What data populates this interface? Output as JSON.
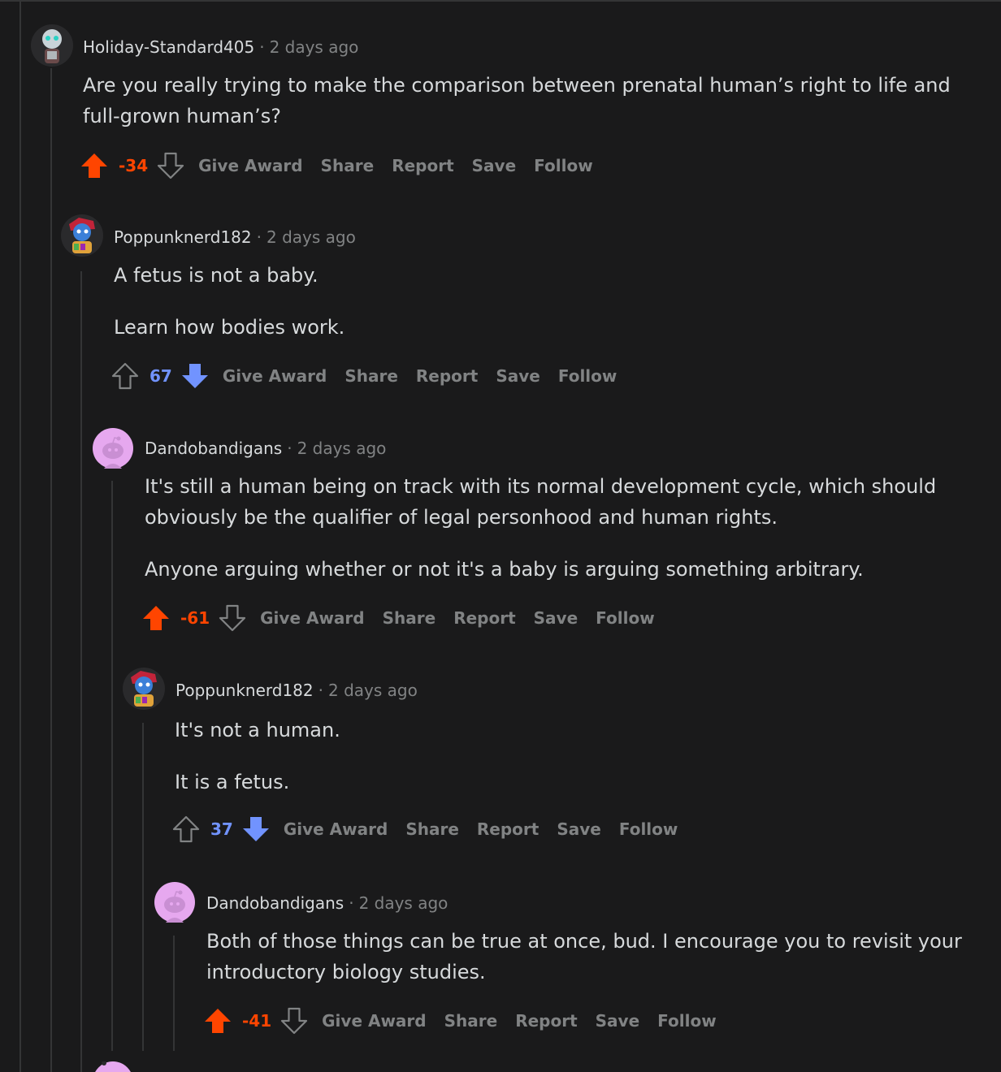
{
  "comments": [
    {
      "username": "Holiday-Standard405",
      "time": "2 days ago",
      "avatar": "snoo-avatar-grey",
      "paragraphs": [
        "Are you really trying to make the comparison between prenatal human’s right to life and full-grown human’s?"
      ],
      "score": "-34",
      "vote": "up",
      "actions": [
        "Give Award",
        "Share",
        "Report",
        "Save",
        "Follow"
      ]
    },
    {
      "username": "Poppunknerd182",
      "time": "2 days ago",
      "avatar": "snoo-avatar-rainbow",
      "paragraphs": [
        "A fetus is not a baby.",
        "Learn how bodies work."
      ],
      "score": "67",
      "vote": "down",
      "actions": [
        "Give Award",
        "Share",
        "Report",
        "Save",
        "Follow"
      ]
    },
    {
      "username": "Dandobandigans",
      "time": "2 days ago",
      "avatar": "default-snoo-pink",
      "paragraphs": [
        "It's still a human being on track with its normal development cycle, which should obviously be the qualifier of legal personhood and human rights.",
        "Anyone arguing whether or not it's a baby is arguing something arbitrary."
      ],
      "score": "-61",
      "vote": "up",
      "actions": [
        "Give Award",
        "Share",
        "Report",
        "Save",
        "Follow"
      ]
    },
    {
      "username": "Poppunknerd182",
      "time": "2 days ago",
      "avatar": "snoo-avatar-rainbow",
      "paragraphs": [
        "It's not a human.",
        "It is a fetus."
      ],
      "score": "37",
      "vote": "down",
      "actions": [
        "Give Award",
        "Share",
        "Report",
        "Save",
        "Follow"
      ]
    },
    {
      "username": "Dandobandigans",
      "time": "2 days ago",
      "avatar": "default-snoo-pink",
      "paragraphs": [
        "Both of those things can be true at once, bud. I encourage you to revisit your introductory biology studies."
      ],
      "score": "-41",
      "vote": "up",
      "actions": [
        "Give Award",
        "Share",
        "Report",
        "Save",
        "Follow"
      ]
    }
  ],
  "colors": {
    "background": "#1a1a1b",
    "upvote_active": "#ff4500",
    "downvote_active": "#7193ff",
    "muted": "#818384",
    "text": "#d7dadc"
  }
}
